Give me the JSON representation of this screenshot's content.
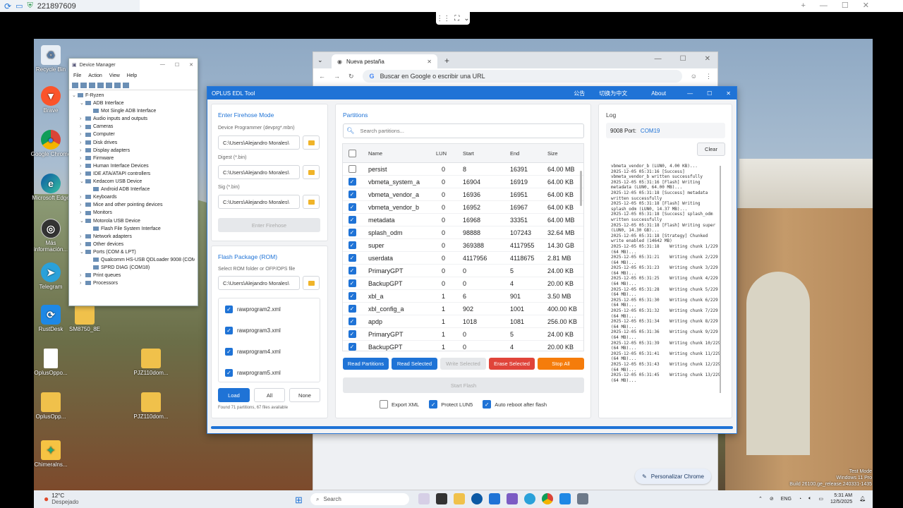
{
  "remote": {
    "session_id": "221897609"
  },
  "desktop": {
    "icons": [
      "Recycle Bin",
      "Brave",
      "Google Chrome",
      "Microsoft Edge",
      "Más información...",
      "Telegram",
      "RustDesk",
      "SM8750_8E",
      "OplusOppo...",
      "OplusOpp...",
      "PJZ110dom...",
      "PJZ110dom...",
      "Chimeralns..."
    ],
    "watermark": [
      "Test Mode",
      "Windows 11 Pro",
      "Build 26100.ge_release.240331-1435"
    ]
  },
  "device_manager": {
    "title": "Device Manager",
    "menu": [
      "File",
      "Action",
      "View",
      "Help"
    ],
    "tree": [
      {
        "t": "F-Ryzen",
        "lvl": 0,
        "s": "v"
      },
      {
        "t": "ADB Interface",
        "lvl": 1,
        "s": "v"
      },
      {
        "t": "Mot Single ADB Interface",
        "lvl": 2,
        "s": ""
      },
      {
        "t": "Audio inputs and outputs",
        "lvl": 1,
        "s": ">"
      },
      {
        "t": "Cameras",
        "lvl": 1,
        "s": ">"
      },
      {
        "t": "Computer",
        "lvl": 1,
        "s": ">"
      },
      {
        "t": "Disk drives",
        "lvl": 1,
        "s": ">"
      },
      {
        "t": "Display adapters",
        "lvl": 1,
        "s": ">"
      },
      {
        "t": "Firmware",
        "lvl": 1,
        "s": ">"
      },
      {
        "t": "Human Interface Devices",
        "lvl": 1,
        "s": ">"
      },
      {
        "t": "IDE ATA/ATAPI controllers",
        "lvl": 1,
        "s": ">"
      },
      {
        "t": "Kedacom USB Device",
        "lvl": 1,
        "s": "v"
      },
      {
        "t": "Android ADB Interface",
        "lvl": 2,
        "s": ""
      },
      {
        "t": "Keyboards",
        "lvl": 1,
        "s": ">"
      },
      {
        "t": "Mice and other pointing devices",
        "lvl": 1,
        "s": ">"
      },
      {
        "t": "Monitors",
        "lvl": 1,
        "s": ">"
      },
      {
        "t": "Motorola USB Device",
        "lvl": 1,
        "s": "v"
      },
      {
        "t": "Flash File System Interface",
        "lvl": 2,
        "s": ""
      },
      {
        "t": "Network adapters",
        "lvl": 1,
        "s": ">"
      },
      {
        "t": "Other devices",
        "lvl": 1,
        "s": ">"
      },
      {
        "t": "Ports (COM & LPT)",
        "lvl": 1,
        "s": "v"
      },
      {
        "t": "Qualcomm HS-USB QDLoader 9008 (COM19)",
        "lvl": 2,
        "s": ""
      },
      {
        "t": "SPRD DIAG (COM18)",
        "lvl": 2,
        "s": ""
      },
      {
        "t": "Print queues",
        "lvl": 1,
        "s": ">"
      },
      {
        "t": "Processors",
        "lvl": 1,
        "s": ">"
      }
    ]
  },
  "chrome": {
    "tab_title": "Nueva pestaña",
    "omnibox_placeholder": "Buscar en Google o escribir una URL",
    "customize_label": "Personalizar Chrome"
  },
  "edl": {
    "title": "OPLUS EDL Tool",
    "header_links": [
      "公告",
      "切换为中文",
      "About"
    ],
    "firehose": {
      "section": "Enter Firehose Mode",
      "programmer_label": "Device Programmer (devprg*.mbn)",
      "programmer_value": "C:\\Users\\Alejandro Morales\\",
      "digest_label": "Digest (*.bin)",
      "digest_value": "C:\\Users\\Alejandro Morales\\",
      "sig_label": "Sig (*.bin)",
      "sig_value": "C:\\Users\\Alejandro Morales\\",
      "enter_button": "Enter Firehose"
    },
    "flash_package": {
      "section": "Flash Package (ROM)",
      "folder_label": "Select ROM folder or OFP/OPS file",
      "folder_value": "C:\\Users\\Alejandro Morales\\",
      "files": [
        {
          "name": "rawprogram2.xml",
          "checked": true
        },
        {
          "name": "rawprogram3.xml",
          "checked": true
        },
        {
          "name": "rawprogram4.xml",
          "checked": true
        },
        {
          "name": "rawprogram5.xml",
          "checked": true
        }
      ],
      "load_button": "Load",
      "all_button": "All",
      "none_button": "None",
      "status": "Found 71 partitions, 67 files available"
    },
    "partitions": {
      "section": "Partitions",
      "search_placeholder": "Search partitions...",
      "columns": [
        "Name",
        "LUN",
        "Start",
        "End",
        "Size"
      ],
      "rows": [
        {
          "checked": false,
          "name": "persist",
          "lun": "0",
          "start": "8",
          "end": "16391",
          "size": "64.00 MB"
        },
        {
          "checked": true,
          "name": "vbmeta_system_a",
          "lun": "0",
          "start": "16904",
          "end": "16919",
          "size": "64.00 KB"
        },
        {
          "checked": true,
          "name": "vbmeta_vendor_a",
          "lun": "0",
          "start": "16936",
          "end": "16951",
          "size": "64.00 KB"
        },
        {
          "checked": true,
          "name": "vbmeta_vendor_b",
          "lun": "0",
          "start": "16952",
          "end": "16967",
          "size": "64.00 KB"
        },
        {
          "checked": true,
          "name": "metadata",
          "lun": "0",
          "start": "16968",
          "end": "33351",
          "size": "64.00 MB"
        },
        {
          "checked": true,
          "name": "splash_odm",
          "lun": "0",
          "start": "98888",
          "end": "107243",
          "size": "32.64 MB"
        },
        {
          "checked": true,
          "name": "super",
          "lun": "0",
          "start": "369388",
          "end": "4117955",
          "size": "14.30 GB"
        },
        {
          "checked": true,
          "name": "userdata",
          "lun": "0",
          "start": "4117956",
          "end": "4118675",
          "size": "2.81 MB"
        },
        {
          "checked": true,
          "name": "PrimaryGPT",
          "lun": "0",
          "start": "0",
          "end": "5",
          "size": "24.00 KB"
        },
        {
          "checked": true,
          "name": "BackupGPT",
          "lun": "0",
          "start": "0",
          "end": "4",
          "size": "20.00 KB"
        },
        {
          "checked": true,
          "name": "xbl_a",
          "lun": "1",
          "start": "6",
          "end": "901",
          "size": "3.50 MB"
        },
        {
          "checked": true,
          "name": "xbl_config_a",
          "lun": "1",
          "start": "902",
          "end": "1001",
          "size": "400.00 KB"
        },
        {
          "checked": true,
          "name": "apdp",
          "lun": "1",
          "start": "1018",
          "end": "1081",
          "size": "256.00 KB"
        },
        {
          "checked": true,
          "name": "PrimaryGPT",
          "lun": "1",
          "start": "0",
          "end": "5",
          "size": "24.00 KB"
        },
        {
          "checked": true,
          "name": "BackupGPT",
          "lun": "1",
          "start": "0",
          "end": "4",
          "size": "20.00 KB"
        }
      ],
      "buttons": {
        "read_partitions": "Read Partitions",
        "read_selected": "Read Selected",
        "write_selected": "Write Selected",
        "erase_selected": "Erase Selected",
        "stop_all": "Stop All",
        "start_flash": "Start Flash"
      },
      "options": [
        {
          "label": "Export XML",
          "checked": false
        },
        {
          "label": "Protect LUN5",
          "checked": true
        },
        {
          "label": "Auto reboot after flash",
          "checked": true
        }
      ]
    },
    "log": {
      "section": "Log",
      "port_label": "9008 Port:",
      "port_value": "COM19",
      "clear_button": "Clear",
      "lines": [
        "vbmeta_vendor_b (LUN0, 4.00 KB)...",
        "2025-12-05 05:31:16 [Success]",
        "vbmeta_vendor_b written successfully",
        "2025-12-05 05:31:16 [Flash] Writing",
        "metadata (LUN0, 64.00 MB)...",
        "2025-12-05 05:31:18 [Success] metadata",
        "written successfully",
        "2025-12-05 05:31:18 [Flash] Writing",
        "splash_odm (LUN0, 14.37 MB)...",
        "2025-12-05 05:31:18 [Success] splash_odm",
        "written successfully",
        "2025-12-05 05:31:18 [Flash] Writing super",
        "(LUN0, 14.30 GB)...",
        "2025-12-05 05:31:18 [Strategy] Chunked",
        "write enabled (14642 MB)",
        "2025-12-05 05:31:18    Writing chunk 1/229",
        "(64 MB)...",
        "2025-12-05 05:31:21    Writing chunk 2/229",
        "(64 MB)...",
        "2025-12-05 05:31:23    Writing chunk 3/229",
        "(64 MB)...",
        "2025-12-05 05:31:25    Writing chunk 4/229",
        "(64 MB)...",
        "2025-12-05 05:31:28    Writing chunk 5/229",
        "(64 MB)...",
        "2025-12-05 05:31:30    Writing chunk 6/229",
        "(64 MB)...",
        "2025-12-05 05:31:32    Writing chunk 7/229",
        "(64 MB)...",
        "2025-12-05 05:31:34    Writing chunk 8/229",
        "(64 MB)...",
        "2025-12-05 05:31:36    Writing chunk 9/229",
        "(64 MB)...",
        "2025-12-05 05:31:39    Writing chunk 10/229",
        "(64 MB)...",
        "2025-12-05 05:31:41    Writing chunk 11/229",
        "(64 MB)...",
        "2025-12-05 05:31:43    Writing chunk 12/229",
        "(64 MB)...",
        "2025-12-05 05:31:45    Writing chunk 13/229",
        "(64 MB)..."
      ]
    }
  },
  "taskbar": {
    "weather_temp": "12°C",
    "weather_desc": "Despejado",
    "search_label": "Search",
    "lang": "ENG",
    "time": "5:31 AM",
    "date": "12/5/2025"
  }
}
